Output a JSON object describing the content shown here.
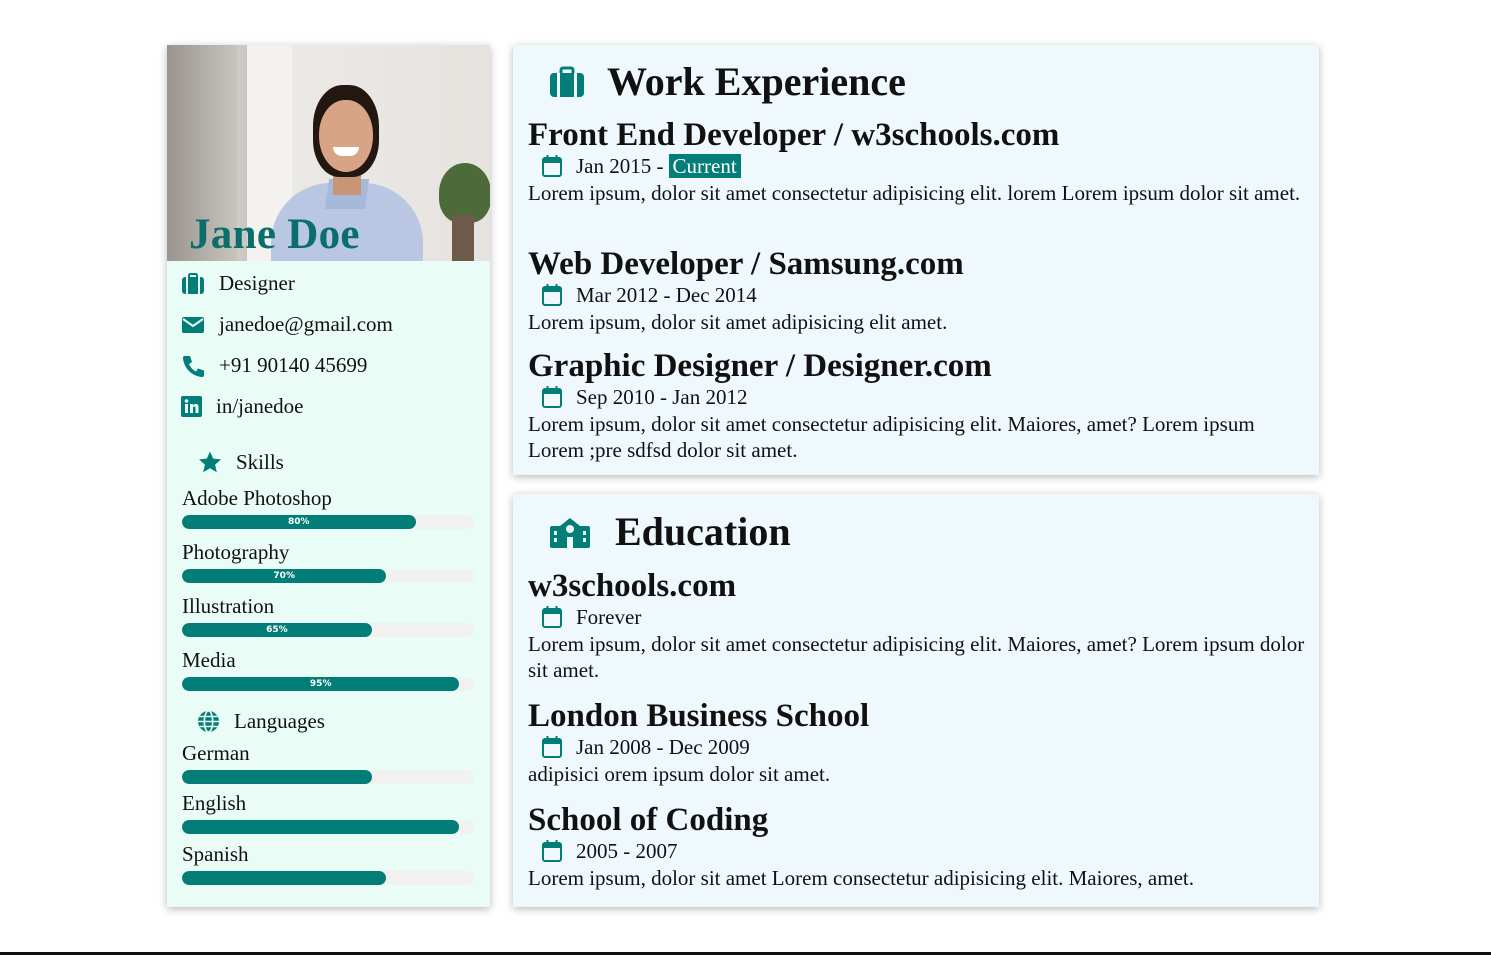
{
  "profile": {
    "name": "Jane Doe",
    "title": "Designer",
    "email": "janedoe@gmail.com",
    "phone": "+91 90140 45699",
    "linkedin": "in/janedoe"
  },
  "skills": {
    "heading": "Skills",
    "items": [
      {
        "label": "Adobe Photoshop",
        "percent": 80,
        "percent_label": "80%"
      },
      {
        "label": "Photography",
        "percent": 70,
        "percent_label": "70%"
      },
      {
        "label": "Illustration",
        "percent": 65,
        "percent_label": "65%"
      },
      {
        "label": "Media",
        "percent": 95,
        "percent_label": "95%"
      }
    ]
  },
  "languages": {
    "heading": "Languages",
    "items": [
      {
        "label": "German",
        "percent": 65
      },
      {
        "label": "English",
        "percent": 95
      },
      {
        "label": "Spanish",
        "percent": 70
      }
    ]
  },
  "work": {
    "heading": "Work Experience",
    "entries": [
      {
        "title": "Front End Developer / w3schools.com",
        "dates": "Jan 2015 -",
        "badge": "Current",
        "desc": "Lorem ipsum, dolor sit amet consectetur adipisicing elit. lorem Lorem ipsum dolor sit amet."
      },
      {
        "title": "Web Developer / Samsung.com",
        "dates": "Mar 2012 - Dec 2014",
        "desc": "Lorem ipsum, dolor sit amet adipisicing elit amet."
      },
      {
        "title": "Graphic Designer / Designer.com",
        "dates": "Sep 2010 - Jan 2012",
        "desc": "Lorem ipsum, dolor sit amet consectetur adipisicing elit. Maiores, amet? Lorem ipsum Lorem ;pre sdfsd dolor sit amet."
      }
    ]
  },
  "education": {
    "heading": "Education",
    "entries": [
      {
        "title": "w3schools.com",
        "dates": "Forever",
        "desc": "Lorem ipsum, dolor sit amet consectetur adipisicing elit. Maiores, amet? Lorem ipsum dolor sit amet."
      },
      {
        "title": "London Business School",
        "dates": "Jan 2008 - Dec 2009",
        "desc": "adipisici orem ipsum dolor sit amet."
      },
      {
        "title": "School of Coding",
        "dates": "2005 - 2007",
        "desc": "Lorem ipsum, dolor sit amet Lorem consectetur adipisicing elit. Maiores, amet."
      }
    ]
  },
  "colors": {
    "accent": "#037d77",
    "left_bg": "#e9fdf6",
    "right_bg": "#eff8fd"
  },
  "icons": {
    "title": "briefcase-icon",
    "email": "envelope-icon",
    "phone": "phone-icon",
    "linkedin": "linkedin-icon",
    "skills": "star-icon",
    "languages": "globe-icon",
    "work": "briefcase-icon",
    "education": "school-icon",
    "date": "calendar-icon"
  }
}
